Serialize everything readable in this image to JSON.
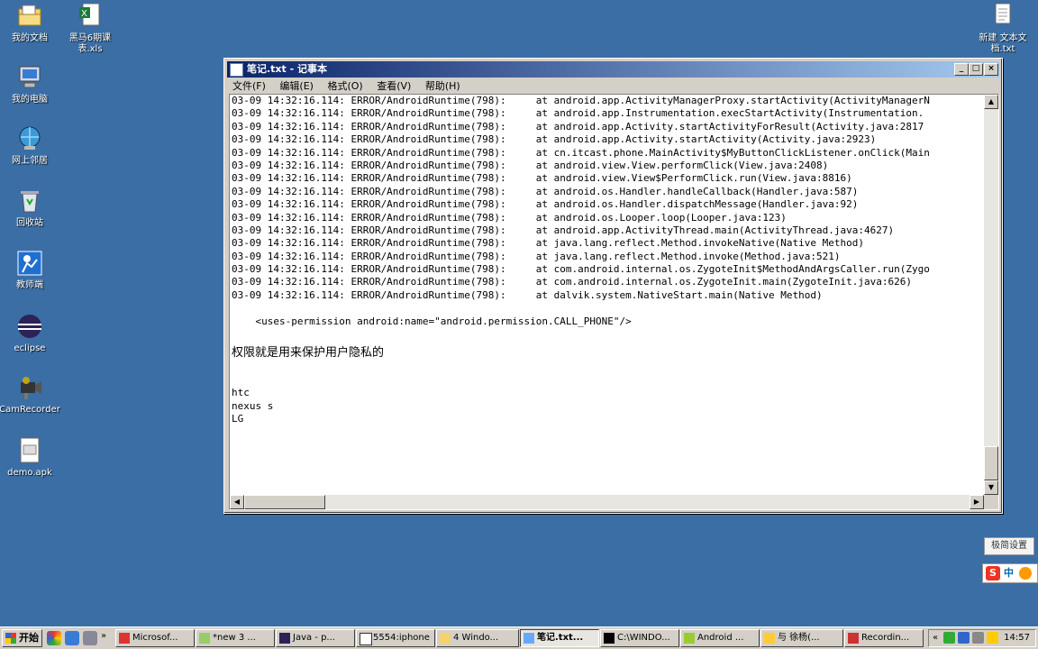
{
  "desktop_icons": [
    {
      "label": "我的文档",
      "icon": "my-documents-icon"
    },
    {
      "label": "黑马6期课表.xls",
      "icon": "excel-file-icon"
    },
    {
      "label": "我的电脑",
      "icon": "my-computer-icon"
    },
    {
      "label": "网上邻居",
      "icon": "network-icon"
    },
    {
      "label": "回收站",
      "icon": "recycle-bin-icon"
    },
    {
      "label": "教师端",
      "icon": "teacher-client-icon"
    },
    {
      "label": "eclipse",
      "icon": "eclipse-icon"
    },
    {
      "label": "CamRecorder",
      "icon": "camrecorder-icon"
    },
    {
      "label": "demo.apk",
      "icon": "apk-file-icon"
    },
    {
      "label": "新建 文本文档.txt",
      "icon": "text-file-icon"
    }
  ],
  "window": {
    "title": "笔记.txt - 记事本",
    "minimize": "_",
    "maximize": "□",
    "close": "×"
  },
  "menu": [
    "文件(F)",
    "编辑(E)",
    "格式(O)",
    "查看(V)",
    "帮助(H)"
  ],
  "editor": {
    "log_lines": [
      "03-09 14:32:16.114: ERROR/AndroidRuntime(798):     at android.app.ActivityManagerProxy.startActivity(ActivityManagerN",
      "03-09 14:32:16.114: ERROR/AndroidRuntime(798):     at android.app.Instrumentation.execStartActivity(Instrumentation.",
      "03-09 14:32:16.114: ERROR/AndroidRuntime(798):     at android.app.Activity.startActivityForResult(Activity.java:2817",
      "03-09 14:32:16.114: ERROR/AndroidRuntime(798):     at android.app.Activity.startActivity(Activity.java:2923)",
      "03-09 14:32:16.114: ERROR/AndroidRuntime(798):     at cn.itcast.phone.MainActivity$MyButtonClickListener.onClick(Main",
      "03-09 14:32:16.114: ERROR/AndroidRuntime(798):     at android.view.View.performClick(View.java:2408)",
      "03-09 14:32:16.114: ERROR/AndroidRuntime(798):     at android.view.View$PerformClick.run(View.java:8816)",
      "03-09 14:32:16.114: ERROR/AndroidRuntime(798):     at android.os.Handler.handleCallback(Handler.java:587)",
      "03-09 14:32:16.114: ERROR/AndroidRuntime(798):     at android.os.Handler.dispatchMessage(Handler.java:92)",
      "03-09 14:32:16.114: ERROR/AndroidRuntime(798):     at android.os.Looper.loop(Looper.java:123)",
      "03-09 14:32:16.114: ERROR/AndroidRuntime(798):     at android.app.ActivityThread.main(ActivityThread.java:4627)",
      "03-09 14:32:16.114: ERROR/AndroidRuntime(798):     at java.lang.reflect.Method.invokeNative(Native Method)",
      "03-09 14:32:16.114: ERROR/AndroidRuntime(798):     at java.lang.reflect.Method.invoke(Method.java:521)",
      "03-09 14:32:16.114: ERROR/AndroidRuntime(798):     at com.android.internal.os.ZygoteInit$MethodAndArgsCaller.run(Zygo",
      "03-09 14:32:16.114: ERROR/AndroidRuntime(798):     at com.android.internal.os.ZygoteInit.main(ZygoteInit.java:626)",
      "03-09 14:32:16.114: ERROR/AndroidRuntime(798):     at dalvik.system.NativeStart.main(Native Method)"
    ],
    "permission_line": "    <uses-permission android:name=\"android.permission.CALL_PHONE\"/>",
    "note_line": "权限就是用来保护用户隐私的",
    "brand_lines": [
      "htc",
      "nexus s",
      "LG"
    ]
  },
  "ime": {
    "settings_label": "极简设置",
    "sogou_label": "S",
    "mode_label": "中"
  },
  "taskbar": {
    "start_label": "开始",
    "tasks": [
      {
        "label": "Microsof...",
        "icon": "office-icon"
      },
      {
        "label": "*new  3 ...",
        "icon": "notepadpp-icon"
      },
      {
        "label": "Java - p...",
        "icon": "eclipse-icon"
      },
      {
        "label": "5554:iphone",
        "icon": "emulator-icon"
      },
      {
        "label": "4 Windo...",
        "icon": "folder-icon"
      },
      {
        "label": "笔记.txt...",
        "icon": "notepad-icon"
      },
      {
        "label": "C:\\WINDO...",
        "icon": "cmd-icon"
      },
      {
        "label": "Android ...",
        "icon": "android-icon"
      },
      {
        "label": "与 徐杨(...",
        "icon": "chat-icon"
      },
      {
        "label": "Recordin...",
        "icon": "recording-icon"
      }
    ],
    "clock": "14:57",
    "colors": {
      "desktop": "#3a6ea5",
      "title_start": "#0a246a",
      "title_end": "#a6caf0"
    }
  }
}
